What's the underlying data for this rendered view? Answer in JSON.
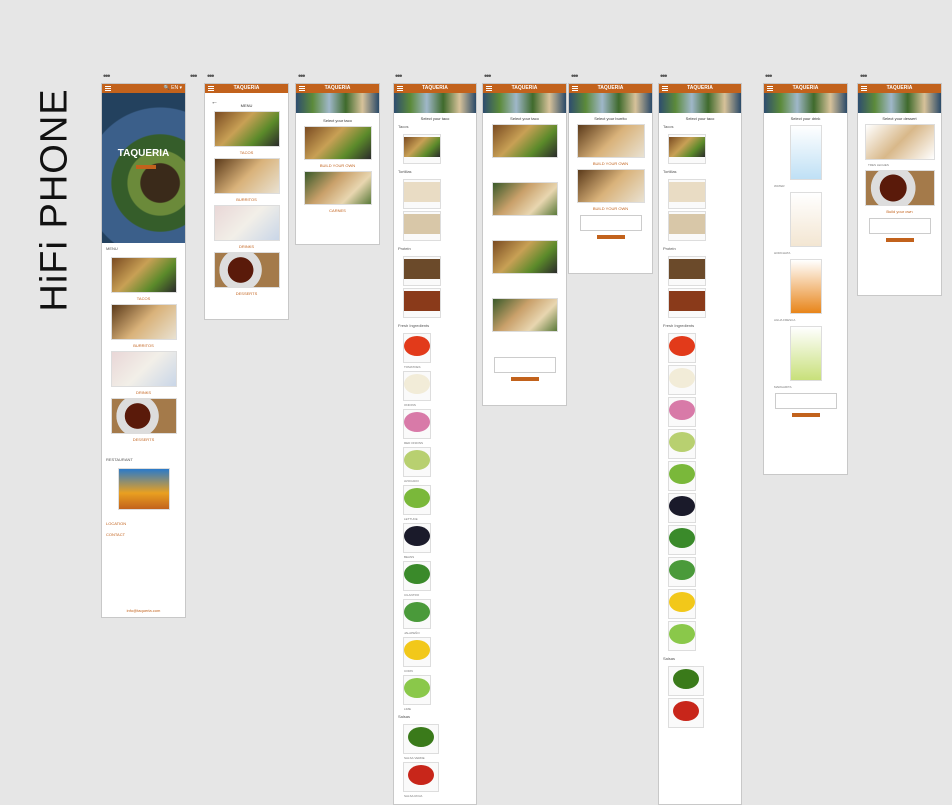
{
  "page_title": "HiFi PHONE",
  "header": {
    "logo": "TAQUERIA",
    "icons_label": "🔍 EN ▾"
  },
  "home": {
    "brand": "TAQUERIA",
    "menu_label": "MENU",
    "items": [
      "TACOS",
      "BURRITOS",
      "DRINKS",
      "DESSERTS"
    ],
    "restaurant_label": "RESTAURANT",
    "location_label": "LOCATION",
    "contact_label": "CONTACT",
    "footer": "info@taqueria.com"
  },
  "menu": {
    "title": "MENU",
    "items": [
      "TACOS",
      "BURRITOS",
      "DRINKS",
      "DESSERTS"
    ]
  },
  "tacos_select": {
    "title": "Select your taco",
    "items": [
      "BUILD YOUR OWN",
      "CARNES"
    ]
  },
  "build": {
    "title": "Select your taco",
    "sections": [
      "Tacos",
      "Tortillas",
      "Protein",
      "Fresh Ingredients",
      "Salsas"
    ],
    "ingredients": [
      "TOMATOES",
      "ONIONS",
      "RED ONIONS",
      "AVOCADO",
      "LETTUCE",
      "BEANS",
      "CILANTRO",
      "JALAPEÑO",
      "CORN",
      "LIME",
      "SALSA VERDE",
      "SALSA ROJA"
    ]
  },
  "carnes": {
    "title": "Select your taco",
    "add_label": "add to the cart"
  },
  "burritos": {
    "title": "Select your burrito",
    "items": [
      "BUILD YOUR OWN",
      "BUILD YOUR OWN"
    ],
    "add_label": "add to the cart"
  },
  "drinks": {
    "title": "Select your drink",
    "items": [
      "WATER",
      "HORCHATA",
      "AGUA FRESCA",
      "MARGARITA"
    ],
    "add_label": "add to the cart"
  },
  "desserts": {
    "title": "Select your dessert",
    "items": [
      "TRES LECHES",
      "Build your own"
    ],
    "add_label": "add to the cart"
  }
}
